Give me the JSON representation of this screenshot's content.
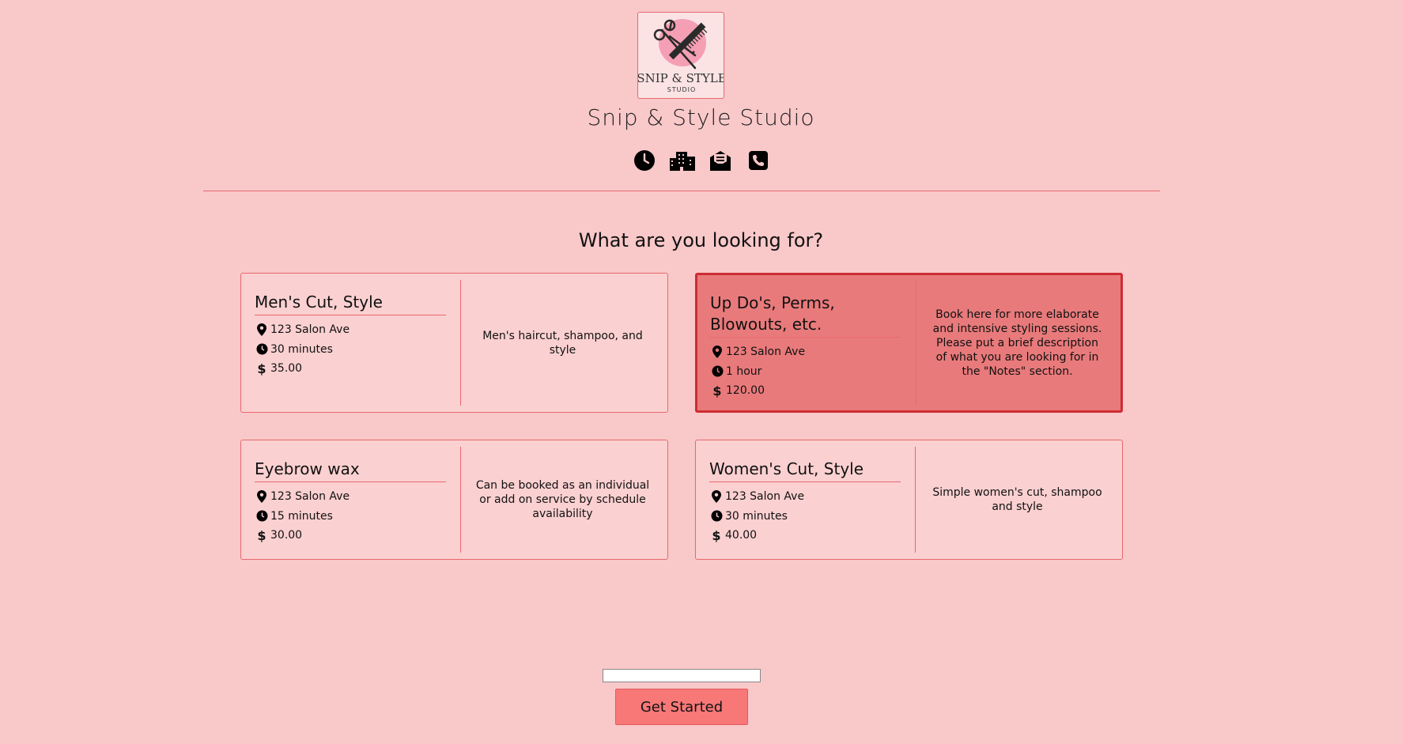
{
  "business": {
    "logo_text_main": "SNIP & STYLE",
    "logo_text_sub": "STUDIO",
    "name": "Snip & Style Studio"
  },
  "contact_icons": [
    "clock-icon",
    "building-icon",
    "envelope-icon",
    "phone-icon"
  ],
  "heading": "What are you looking for?",
  "services": [
    {
      "title": "Men's Cut, Style",
      "location": "123 Salon Ave",
      "duration": "30 minutes",
      "price": "35.00",
      "description": "Men's haircut, shampoo, and style",
      "selected": false
    },
    {
      "title": "Up Do's, Perms, Blowouts, etc.",
      "location": "123 Salon Ave",
      "duration": "1 hour",
      "price": "120.00",
      "description": "Book here for more elaborate and intensive styling sessions. Please put a brief description of what you are looking for in the \"Notes\" section.",
      "selected": true
    },
    {
      "title": "Eyebrow wax",
      "location": "123 Salon Ave",
      "duration": "15 minutes",
      "price": "30.00",
      "description": "Can be booked as an individual or add on service by schedule availability",
      "selected": false
    },
    {
      "title": "Women's Cut, Style",
      "location": "123 Salon Ave",
      "duration": "30 minutes",
      "price": "40.00",
      "description": "Simple women's cut, shampoo and style",
      "selected": false
    }
  ],
  "booking_input": {
    "value": "",
    "placeholder": ""
  },
  "cta": {
    "label": "Get Started"
  },
  "colors": {
    "background": "#f9c8c9",
    "card_background": "#fbd0d1",
    "card_border": "#e8696d",
    "selected_background": "#e97a7b",
    "selected_border": "#cc2d33",
    "button": "#f87878"
  }
}
